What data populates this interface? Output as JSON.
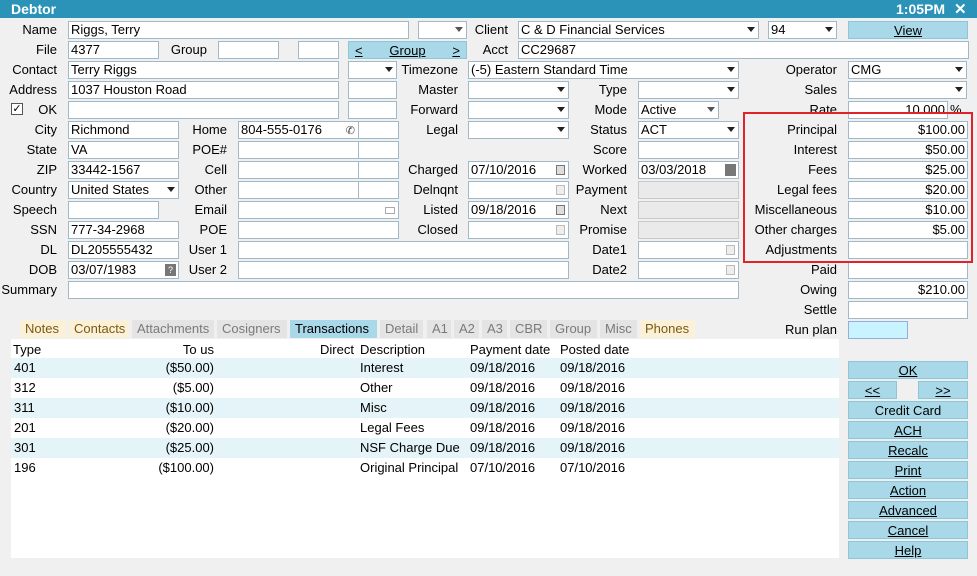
{
  "window": {
    "title": "Debtor",
    "clock": "1:05PM",
    "close_glyph": "✕"
  },
  "labels": {
    "name": "Name",
    "file": "File",
    "group": "Group",
    "contact": "Contact",
    "address": "Address",
    "ok": "OK",
    "city": "City",
    "home": "Home",
    "state": "State",
    "poe_num": "POE#",
    "zip": "ZIP",
    "cell": "Cell",
    "country": "Country",
    "other": "Other",
    "speech": "Speech",
    "email": "Email",
    "ssn": "SSN",
    "poe": "POE",
    "dl": "DL",
    "user1": "User 1",
    "dob": "DOB",
    "user2": "User 2",
    "summary": "Summary",
    "client": "Client",
    "acct": "Acct",
    "timezone": "Timezone",
    "master": "Master",
    "forward": "Forward",
    "legal": "Legal",
    "charged": "Charged",
    "delnqnt": "Delnqnt",
    "listed": "Listed",
    "closed": "Closed",
    "type": "Type",
    "mode": "Mode",
    "status": "Status",
    "score": "Score",
    "worked": "Worked",
    "payment": "Payment",
    "next": "Next",
    "promise": "Promise",
    "date1": "Date1",
    "date2": "Date2",
    "operator": "Operator",
    "sales": "Sales",
    "rate": "Rate",
    "principal": "Principal",
    "interest": "Interest",
    "fees": "Fees",
    "legal_fees": "Legal fees",
    "miscellaneous": "Miscellaneous",
    "other_charges": "Other charges",
    "adjustments": "Adjustments",
    "paid": "Paid",
    "owing": "Owing",
    "settle": "Settle",
    "run_plan": "Run plan"
  },
  "fields": {
    "name": "Riggs, Terry",
    "file": "4377",
    "contact": "Terry Riggs",
    "address": "1037 Houston Road",
    "city": "Richmond",
    "home": "804-555-0176",
    "state": "VA",
    "zip": "33442-1567",
    "country": "United States",
    "ssn": "777-34-2968",
    "dl": "DL205555432",
    "dob": "03/07/1983",
    "client": "C & D Financial Services",
    "client_code": "94",
    "acct": "CC29687",
    "timezone": "(-5) Eastern Standard Time",
    "charged": "07/10/2016",
    "listed": "09/18/2016",
    "mode": "Active",
    "status": "ACT",
    "worked": "03/03/2018",
    "operator": "CMG",
    "rate": "10.000",
    "rate_unit": "%",
    "principal": "$100.00",
    "interest": "$50.00",
    "fees": "$25.00",
    "legal_fees": "$20.00",
    "miscellaneous": "$10.00",
    "other_charges": "$5.00",
    "adjustments": "",
    "paid": "",
    "owing": "$210.00",
    "settle": ""
  },
  "buttons": {
    "view": "View",
    "group_prev": "<",
    "group": "Group",
    "group_next": ">",
    "ok": "OK",
    "prev": "<<",
    "next": ">>",
    "credit_card": "Credit Card",
    "ach": "ACH",
    "recalc": "Recalc",
    "print": "Print",
    "action": "Action",
    "advanced": "Advanced",
    "cancel": "Cancel",
    "help": "Help"
  },
  "tabs": [
    "Notes",
    "Contacts",
    "Attachments",
    "Cosigners",
    "Transactions",
    "Detail",
    "A1",
    "A2",
    "A3",
    "CBR",
    "Group",
    "Misc",
    "Phones"
  ],
  "active_tab": "Transactions",
  "table": {
    "headers": [
      "Type",
      "To us",
      "Direct",
      "Description",
      "Payment date",
      "Posted date"
    ],
    "rows": [
      [
        "401",
        "($50.00)",
        "",
        "Interest",
        "09/18/2016",
        "09/18/2016"
      ],
      [
        "312",
        "($5.00)",
        "",
        "Other",
        "09/18/2016",
        "09/18/2016"
      ],
      [
        "311",
        "($10.00)",
        "",
        "Misc",
        "09/18/2016",
        "09/18/2016"
      ],
      [
        "201",
        "($20.00)",
        "",
        "Legal Fees",
        "09/18/2016",
        "09/18/2016"
      ],
      [
        "301",
        "($25.00)",
        "",
        "NSF Charge Due",
        "09/18/2016",
        "09/18/2016"
      ],
      [
        "196",
        "($100.00)",
        "",
        "Original Principal",
        "07/10/2016",
        "07/10/2016"
      ]
    ]
  },
  "colors": {
    "title_bar": "#2b93b8",
    "button": "#a9d9e8",
    "highlight_box": "#e0222a"
  }
}
